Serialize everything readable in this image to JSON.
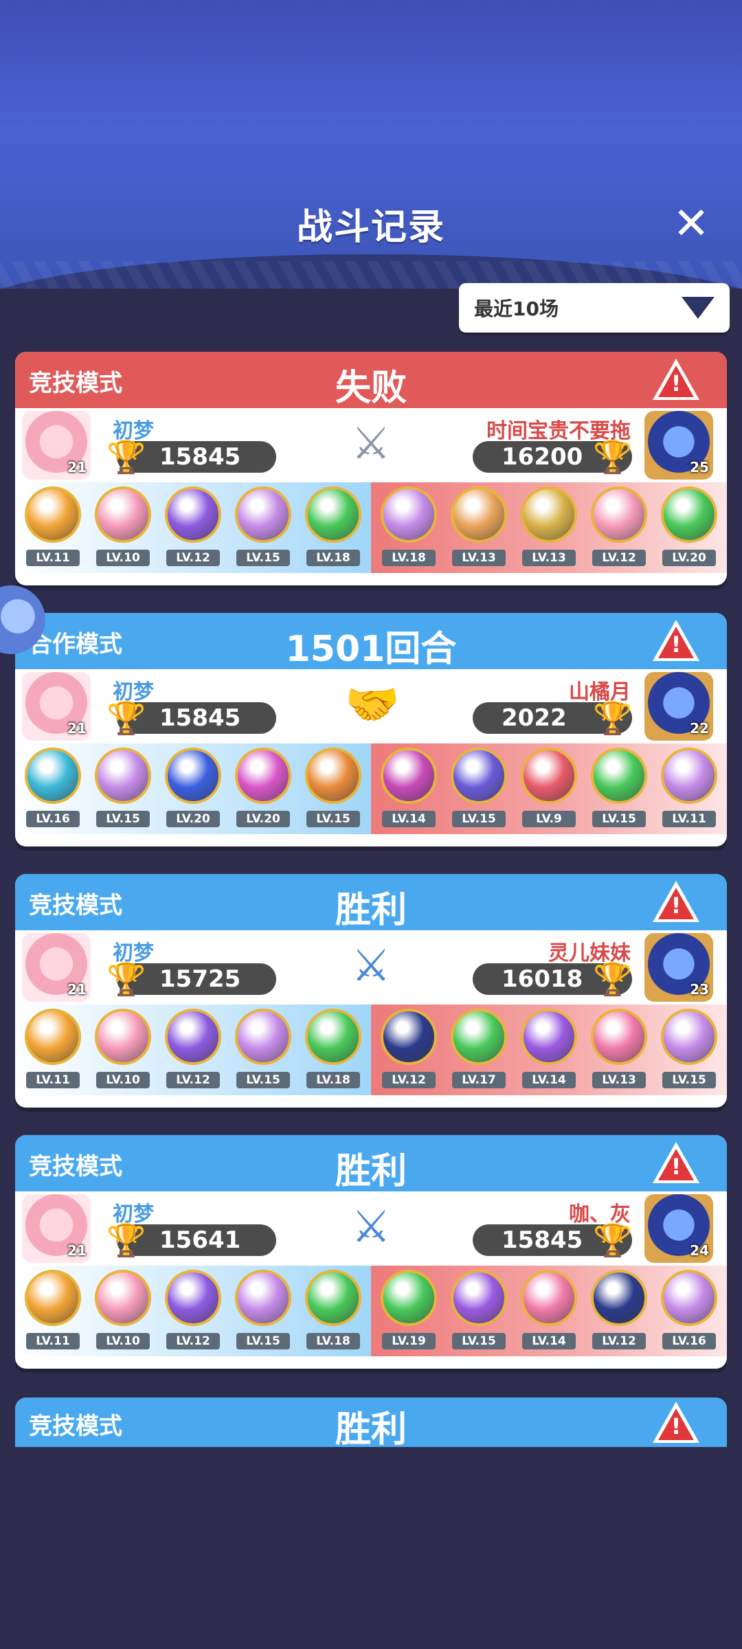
{
  "header": {
    "title": "战斗记录",
    "close_symbol": "✕"
  },
  "filter": {
    "label": "最近10场"
  },
  "colors": {
    "win_bar": "#4aa9ee",
    "lose_bar": "#e05a5a",
    "coop_bar": "#4aa9ee"
  },
  "records": [
    {
      "mode": "竞技模式",
      "result": "失败",
      "bar": "red",
      "center_icon": "swords-gray-icon",
      "center_symbol": "⚔",
      "left": {
        "name": "初梦",
        "score": "15845",
        "level": "21",
        "skills": [
          {
            "lv": "LV.11",
            "color": "#f2a436"
          },
          {
            "lv": "LV.10",
            "color": "#f59ab8"
          },
          {
            "lv": "LV.12",
            "color": "#8c5be0"
          },
          {
            "lv": "LV.15",
            "color": "#c58be8"
          },
          {
            "lv": "LV.18",
            "color": "#49c85a"
          }
        ]
      },
      "right": {
        "name": "时间宝贵不要拖",
        "score": "16200",
        "level": "25",
        "skills": [
          {
            "lv": "LV.18",
            "color": "#c58be8"
          },
          {
            "lv": "LV.13",
            "color": "#e8a35a"
          },
          {
            "lv": "LV.13",
            "color": "#d8b24a"
          },
          {
            "lv": "LV.12",
            "color": "#f59ab8"
          },
          {
            "lv": "LV.20",
            "color": "#49c85a"
          }
        ]
      }
    },
    {
      "mode": "合作模式",
      "result": "1501回合",
      "bar": "blue",
      "center_icon": "handshake-icon",
      "center_symbol": "🤝",
      "left": {
        "name": "初梦",
        "score": "15845",
        "level": "21",
        "skills": [
          {
            "lv": "LV.16",
            "color": "#3bb8d8"
          },
          {
            "lv": "LV.15",
            "color": "#c58be8"
          },
          {
            "lv": "LV.20",
            "color": "#3b5fe0"
          },
          {
            "lv": "LV.20",
            "color": "#d856c8"
          },
          {
            "lv": "LV.15",
            "color": "#e88a3a"
          }
        ]
      },
      "right": {
        "name": "山橘月",
        "score": "2022",
        "level": "22",
        "skills": [
          {
            "lv": "LV.14",
            "color": "#c84ab8"
          },
          {
            "lv": "LV.15",
            "color": "#6a5ad8"
          },
          {
            "lv": "LV.9",
            "color": "#e85a6a"
          },
          {
            "lv": "LV.15",
            "color": "#49c85a"
          },
          {
            "lv": "LV.11",
            "color": "#c58be8"
          }
        ]
      }
    },
    {
      "mode": "竞技模式",
      "result": "胜利",
      "bar": "blue",
      "center_icon": "swords-blue-icon",
      "center_symbol": "⚔",
      "left": {
        "name": "初梦",
        "score": "15725",
        "level": "21",
        "skills": [
          {
            "lv": "LV.11",
            "color": "#f2a436"
          },
          {
            "lv": "LV.10",
            "color": "#f59ab8"
          },
          {
            "lv": "LV.12",
            "color": "#8c5be0"
          },
          {
            "lv": "LV.15",
            "color": "#c58be8"
          },
          {
            "lv": "LV.18",
            "color": "#49c85a"
          }
        ]
      },
      "right": {
        "name": "灵儿妹妹",
        "score": "16018",
        "level": "23",
        "skills": [
          {
            "lv": "LV.12",
            "color": "#2c3a8c"
          },
          {
            "lv": "LV.17",
            "color": "#49c85a"
          },
          {
            "lv": "LV.14",
            "color": "#9a5ae0"
          },
          {
            "lv": "LV.13",
            "color": "#f07aa8"
          },
          {
            "lv": "LV.15",
            "color": "#c58be8"
          }
        ]
      }
    },
    {
      "mode": "竞技模式",
      "result": "胜利",
      "bar": "blue",
      "center_icon": "swords-blue-icon",
      "center_symbol": "⚔",
      "left": {
        "name": "初梦",
        "score": "15641",
        "level": "21",
        "skills": [
          {
            "lv": "LV.11",
            "color": "#f2a436"
          },
          {
            "lv": "LV.10",
            "color": "#f59ab8"
          },
          {
            "lv": "LV.12",
            "color": "#8c5be0"
          },
          {
            "lv": "LV.15",
            "color": "#c58be8"
          },
          {
            "lv": "LV.18",
            "color": "#49c85a"
          }
        ]
      },
      "right": {
        "name": "咖、灰",
        "score": "15845",
        "level": "24",
        "skills": [
          {
            "lv": "LV.19",
            "color": "#49c85a"
          },
          {
            "lv": "LV.15",
            "color": "#9a5ae0"
          },
          {
            "lv": "LV.14",
            "color": "#f07aa8"
          },
          {
            "lv": "LV.12",
            "color": "#2c3a8c"
          },
          {
            "lv": "LV.16",
            "color": "#c58be8"
          }
        ]
      }
    }
  ],
  "partial": {
    "mode": "竞技模式",
    "result": "胜利",
    "warn_mark": "!"
  },
  "warn_mark": "!",
  "trophy_symbol": "🏆"
}
